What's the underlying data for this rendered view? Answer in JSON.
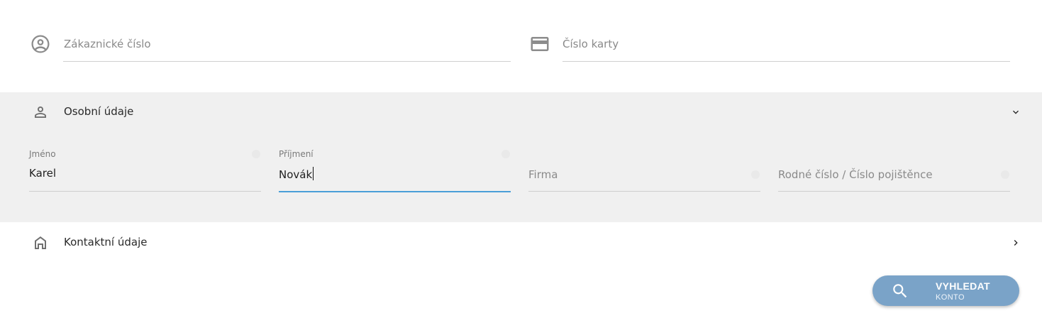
{
  "top_fields": {
    "customer_number": {
      "placeholder": "Zákaznické číslo",
      "icon": "account-circle-icon"
    },
    "card_number": {
      "placeholder": "Číslo karty",
      "icon": "credit-card-icon"
    }
  },
  "personal_section": {
    "title": "Osobní údaje",
    "icon": "person-icon",
    "expanded": true,
    "fields": {
      "first_name": {
        "label": "Jméno",
        "value": "Karel"
      },
      "last_name": {
        "label": "Příjmení",
        "value": "Novák"
      },
      "company": {
        "placeholder": "Firma"
      },
      "birth_number": {
        "placeholder": "Rodné číslo / Číslo pojištěnce"
      }
    }
  },
  "contact_section": {
    "title": "Kontaktní údaje",
    "icon": "home-icon",
    "expanded": false
  },
  "search_button": {
    "label": "VYHLEDAT",
    "sublabel": "KONTO",
    "icon": "search-icon"
  },
  "colors": {
    "accent": "#4a9fd8",
    "button": "#7aa3c8",
    "section_bg": "#f0f0f0"
  }
}
